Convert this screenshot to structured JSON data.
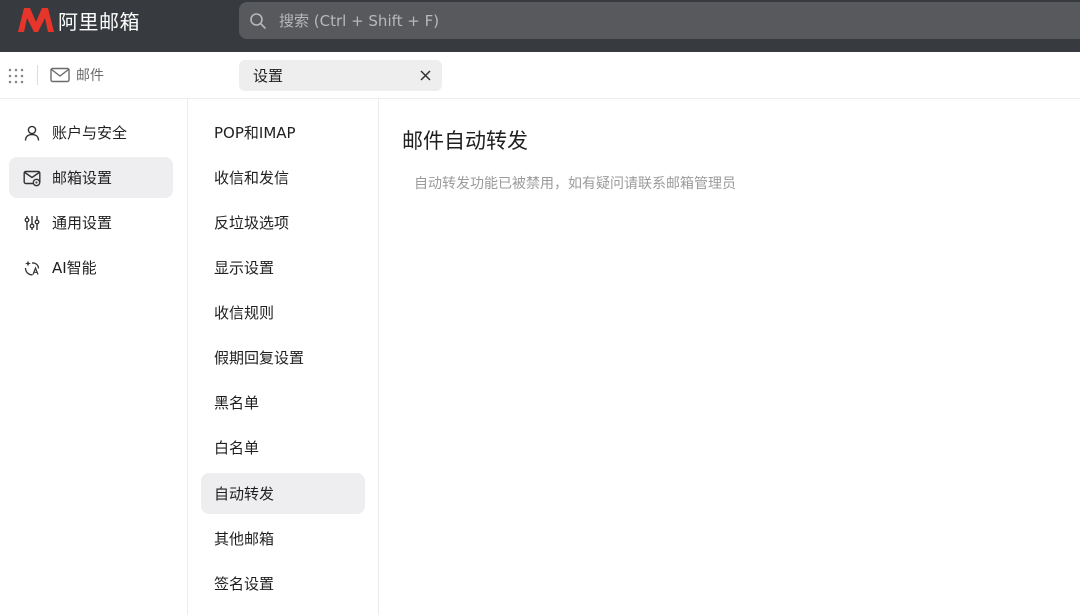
{
  "app": {
    "brand_name": "阿里邮箱",
    "brand_color": "#e8352b"
  },
  "header": {
    "search_placeholder": "搜索 (Ctrl + Shift + F)",
    "search_icon": "search-icon"
  },
  "tabs": {
    "apps_icon": "grid-icon",
    "mail_label": "邮件",
    "settings_label": "设置"
  },
  "leftnav": {
    "items": [
      {
        "label": "账户与安全",
        "icon": "user-icon"
      },
      {
        "label": "邮箱设置",
        "icon": "mailbox-settings-icon",
        "active": true
      },
      {
        "label": "通用设置",
        "icon": "sliders-icon"
      },
      {
        "label": "AI智能",
        "icon": "ai-sparkle-icon"
      }
    ]
  },
  "submenu": {
    "items": [
      {
        "label": "POP和IMAP"
      },
      {
        "label": "收信和发信"
      },
      {
        "label": "反垃圾选项"
      },
      {
        "label": "显示设置"
      },
      {
        "label": "收信规则"
      },
      {
        "label": "假期回复设置"
      },
      {
        "label": "黑名单"
      },
      {
        "label": "白名单"
      },
      {
        "label": "自动转发",
        "active": true
      },
      {
        "label": "其他邮箱"
      },
      {
        "label": "签名设置"
      }
    ]
  },
  "content": {
    "title": "邮件自动转发",
    "note": "自动转发功能已被禁用，如有疑问请联系邮箱管理员"
  }
}
